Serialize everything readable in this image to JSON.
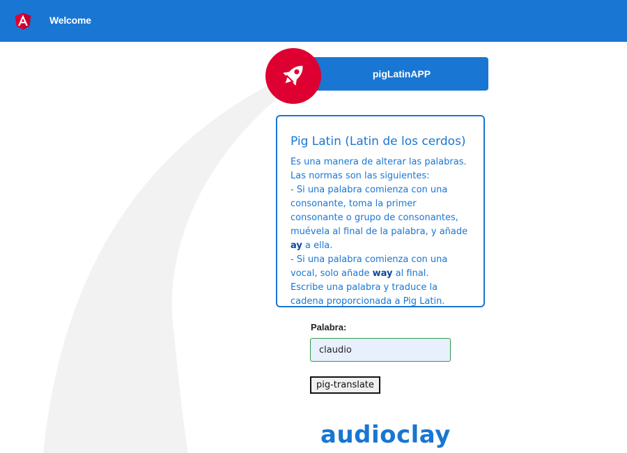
{
  "header": {
    "title": "Welcome",
    "logo_icon": "angular-logo-icon",
    "brand_color": "#1976d2",
    "logo_color": "#dd0031"
  },
  "banner": {
    "title": "pigLatinAPP",
    "icon": "rocket-icon"
  },
  "card": {
    "heading": "Pig Latin (Latin de los cerdos)",
    "line1": "Es una manera de alterar las palabras. Las normas son las siguientes:",
    "rule1_prefix": "- Si una palabra comienza con una consonante, toma la primer consonante o grupo de consonantes, muévela al final de la palabra, y añade ",
    "rule1_bold": "ay",
    "rule1_suffix": " a ella.",
    "rule2_prefix": "- Si una palabra comienza con una vocal, solo añade ",
    "rule2_bold": "way",
    "rule2_suffix": " al final.",
    "line_last": "Escribe una palabra y traduce la cadena proporcionada a Pig Latin."
  },
  "form": {
    "label": "Palabra:",
    "input_value": "claudio",
    "button_label": "pig-translate"
  },
  "result": {
    "text": "audioclay"
  }
}
